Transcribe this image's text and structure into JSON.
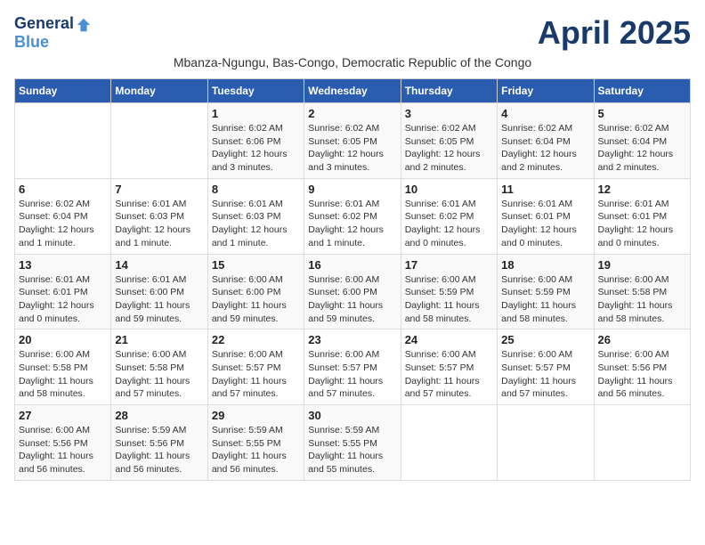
{
  "logo": {
    "general": "General",
    "blue": "Blue"
  },
  "title": "April 2025",
  "subtitle": "Mbanza-Ngungu, Bas-Congo, Democratic Republic of the Congo",
  "days_of_week": [
    "Sunday",
    "Monday",
    "Tuesday",
    "Wednesday",
    "Thursday",
    "Friday",
    "Saturday"
  ],
  "weeks": [
    [
      {
        "day": "",
        "info": ""
      },
      {
        "day": "",
        "info": ""
      },
      {
        "day": "1",
        "info": "Sunrise: 6:02 AM\nSunset: 6:06 PM\nDaylight: 12 hours and 3 minutes."
      },
      {
        "day": "2",
        "info": "Sunrise: 6:02 AM\nSunset: 6:05 PM\nDaylight: 12 hours and 3 minutes."
      },
      {
        "day": "3",
        "info": "Sunrise: 6:02 AM\nSunset: 6:05 PM\nDaylight: 12 hours and 2 minutes."
      },
      {
        "day": "4",
        "info": "Sunrise: 6:02 AM\nSunset: 6:04 PM\nDaylight: 12 hours and 2 minutes."
      },
      {
        "day": "5",
        "info": "Sunrise: 6:02 AM\nSunset: 6:04 PM\nDaylight: 12 hours and 2 minutes."
      }
    ],
    [
      {
        "day": "6",
        "info": "Sunrise: 6:02 AM\nSunset: 6:04 PM\nDaylight: 12 hours and 1 minute."
      },
      {
        "day": "7",
        "info": "Sunrise: 6:01 AM\nSunset: 6:03 PM\nDaylight: 12 hours and 1 minute."
      },
      {
        "day": "8",
        "info": "Sunrise: 6:01 AM\nSunset: 6:03 PM\nDaylight: 12 hours and 1 minute."
      },
      {
        "day": "9",
        "info": "Sunrise: 6:01 AM\nSunset: 6:02 PM\nDaylight: 12 hours and 1 minute."
      },
      {
        "day": "10",
        "info": "Sunrise: 6:01 AM\nSunset: 6:02 PM\nDaylight: 12 hours and 0 minutes."
      },
      {
        "day": "11",
        "info": "Sunrise: 6:01 AM\nSunset: 6:01 PM\nDaylight: 12 hours and 0 minutes."
      },
      {
        "day": "12",
        "info": "Sunrise: 6:01 AM\nSunset: 6:01 PM\nDaylight: 12 hours and 0 minutes."
      }
    ],
    [
      {
        "day": "13",
        "info": "Sunrise: 6:01 AM\nSunset: 6:01 PM\nDaylight: 12 hours and 0 minutes."
      },
      {
        "day": "14",
        "info": "Sunrise: 6:01 AM\nSunset: 6:00 PM\nDaylight: 11 hours and 59 minutes."
      },
      {
        "day": "15",
        "info": "Sunrise: 6:00 AM\nSunset: 6:00 PM\nDaylight: 11 hours and 59 minutes."
      },
      {
        "day": "16",
        "info": "Sunrise: 6:00 AM\nSunset: 6:00 PM\nDaylight: 11 hours and 59 minutes."
      },
      {
        "day": "17",
        "info": "Sunrise: 6:00 AM\nSunset: 5:59 PM\nDaylight: 11 hours and 58 minutes."
      },
      {
        "day": "18",
        "info": "Sunrise: 6:00 AM\nSunset: 5:59 PM\nDaylight: 11 hours and 58 minutes."
      },
      {
        "day": "19",
        "info": "Sunrise: 6:00 AM\nSunset: 5:58 PM\nDaylight: 11 hours and 58 minutes."
      }
    ],
    [
      {
        "day": "20",
        "info": "Sunrise: 6:00 AM\nSunset: 5:58 PM\nDaylight: 11 hours and 58 minutes."
      },
      {
        "day": "21",
        "info": "Sunrise: 6:00 AM\nSunset: 5:58 PM\nDaylight: 11 hours and 57 minutes."
      },
      {
        "day": "22",
        "info": "Sunrise: 6:00 AM\nSunset: 5:57 PM\nDaylight: 11 hours and 57 minutes."
      },
      {
        "day": "23",
        "info": "Sunrise: 6:00 AM\nSunset: 5:57 PM\nDaylight: 11 hours and 57 minutes."
      },
      {
        "day": "24",
        "info": "Sunrise: 6:00 AM\nSunset: 5:57 PM\nDaylight: 11 hours and 57 minutes."
      },
      {
        "day": "25",
        "info": "Sunrise: 6:00 AM\nSunset: 5:57 PM\nDaylight: 11 hours and 57 minutes."
      },
      {
        "day": "26",
        "info": "Sunrise: 6:00 AM\nSunset: 5:56 PM\nDaylight: 11 hours and 56 minutes."
      }
    ],
    [
      {
        "day": "27",
        "info": "Sunrise: 6:00 AM\nSunset: 5:56 PM\nDaylight: 11 hours and 56 minutes."
      },
      {
        "day": "28",
        "info": "Sunrise: 5:59 AM\nSunset: 5:56 PM\nDaylight: 11 hours and 56 minutes."
      },
      {
        "day": "29",
        "info": "Sunrise: 5:59 AM\nSunset: 5:55 PM\nDaylight: 11 hours and 56 minutes."
      },
      {
        "day": "30",
        "info": "Sunrise: 5:59 AM\nSunset: 5:55 PM\nDaylight: 11 hours and 55 minutes."
      },
      {
        "day": "",
        "info": ""
      },
      {
        "day": "",
        "info": ""
      },
      {
        "day": "",
        "info": ""
      }
    ]
  ]
}
